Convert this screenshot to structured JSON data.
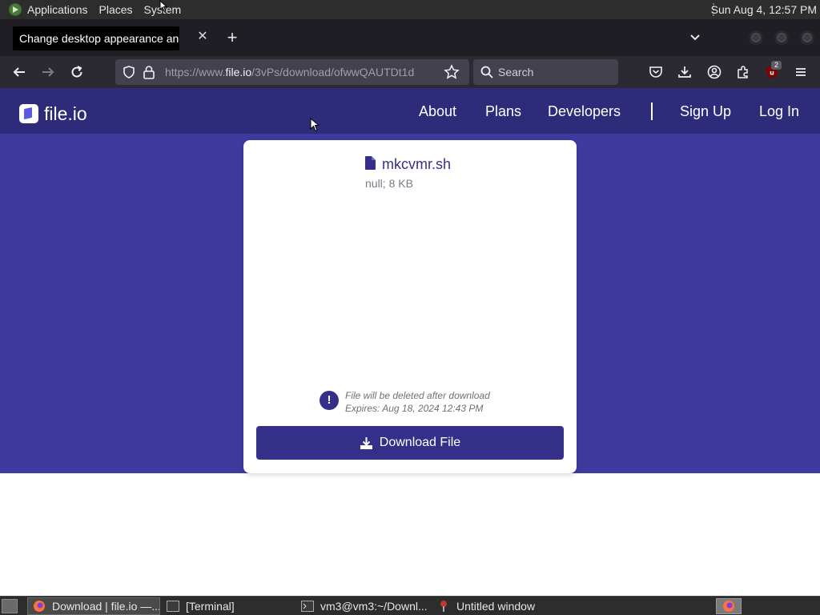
{
  "system_panel": {
    "menus": [
      "Applications",
      "Places",
      "System"
    ],
    "clock": "Sun Aug  4, 12:57 PM"
  },
  "browser": {
    "tooltip": "Change desktop appearance and",
    "url_prefix": "https://www.",
    "url_host": "file.io",
    "url_path": "/3vPs/download/ofwwQAUTDt1d",
    "search_placeholder": "Search",
    "extension_badge": "2"
  },
  "site": {
    "brand": "file.io",
    "nav": {
      "about": "About",
      "plans": "Plans",
      "developers": "Developers",
      "sign_up": "Sign Up",
      "log_in": "Log In"
    },
    "colors": {
      "header": "#2e2b7a",
      "hero": "#3f3a9e",
      "accent": "#34308a"
    }
  },
  "file": {
    "name": "mkcvmr.sh",
    "meta": "null; 8 KB",
    "notice_line1": "File will be deleted after download",
    "notice_line2": "Expires: Aug 18, 2024 12:43 PM",
    "download_label": "Download File"
  },
  "taskbar": {
    "tasks": [
      {
        "label": "Download | file.io —...",
        "icon": "firefox-icon"
      },
      {
        "label": "[Terminal]",
        "icon": "terminal-icon"
      },
      {
        "label": "vm3@vm3:~/Downl...",
        "icon": "terminal-icon"
      },
      {
        "label": "Untitled window",
        "icon": "window-icon"
      }
    ]
  }
}
